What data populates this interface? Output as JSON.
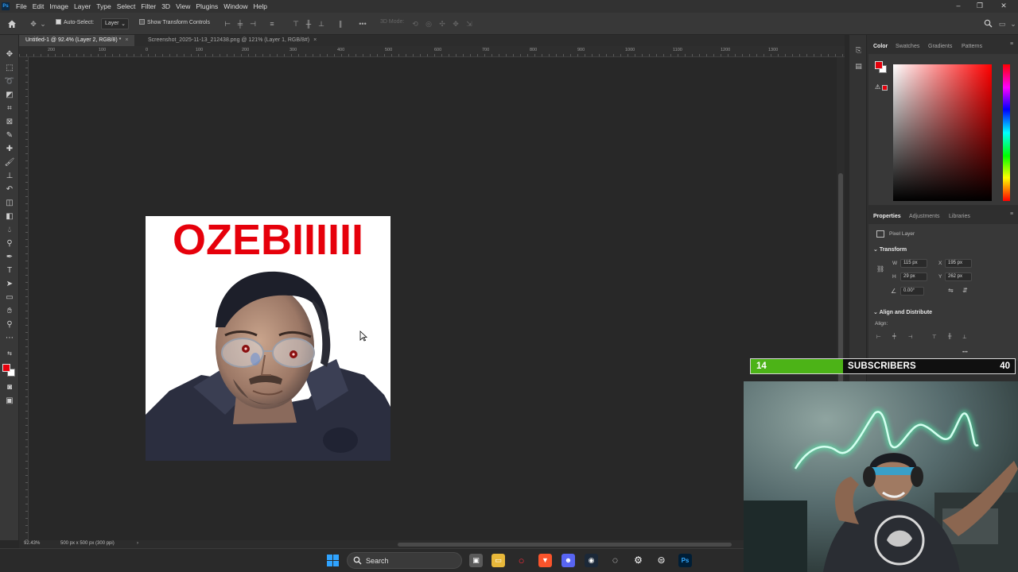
{
  "menu": {
    "app_icon": "Ps",
    "items": [
      "File",
      "Edit",
      "Image",
      "Layer",
      "Type",
      "Select",
      "Filter",
      "3D",
      "View",
      "Plugins",
      "Window",
      "Help"
    ]
  },
  "options_bar": {
    "auto_select_label": "Auto-Select:",
    "auto_select_target": "Layer",
    "transform_controls_label": "Show Transform Controls",
    "mode_3d_label": "3D Mode:"
  },
  "tabs": [
    {
      "label": "Untitled-1 @ 92.4% (Layer 2, RGB/8) *",
      "active": true
    },
    {
      "label": "Screenshot_2025-11-13_212438.png @ 121% (Layer 1, RGB/8#)",
      "active": false
    }
  ],
  "ruler": {
    "ticks": [
      "200",
      "100",
      "0",
      "100",
      "200",
      "300",
      "400",
      "500",
      "600",
      "700",
      "800",
      "900",
      "1000",
      "1100",
      "1200",
      "1300"
    ]
  },
  "canvas": {
    "text": "OZEBIIIIII"
  },
  "status": {
    "zoom": "92.43%",
    "doc_info": "500 px x 500 px (300 ppi)"
  },
  "color_panel": {
    "tabs": [
      "Color",
      "Swatches",
      "Gradients",
      "Patterns"
    ],
    "foreground": "#e6000b",
    "background": "#ffffff"
  },
  "properties_panel": {
    "tabs": [
      "Properties",
      "Adjustments",
      "Libraries"
    ],
    "layer_type": "Pixel Layer",
    "transform_label": "Transform",
    "w_label": "W",
    "w_value": "115 px",
    "x_label": "X",
    "x_value": "195 px",
    "h_label": "H",
    "h_value": "29 px",
    "y_label": "Y",
    "y_value": "262 px",
    "angle_value": "0.00°",
    "align_label": "Align and Distribute",
    "align_sub": "Align:"
  },
  "subscriber_goal": {
    "current": "14",
    "label": "SUBSCRIBERS",
    "goal": "40",
    "progress": 0.35,
    "fill_color": "#4cb317"
  },
  "taskbar": {
    "search_placeholder": "Search"
  }
}
